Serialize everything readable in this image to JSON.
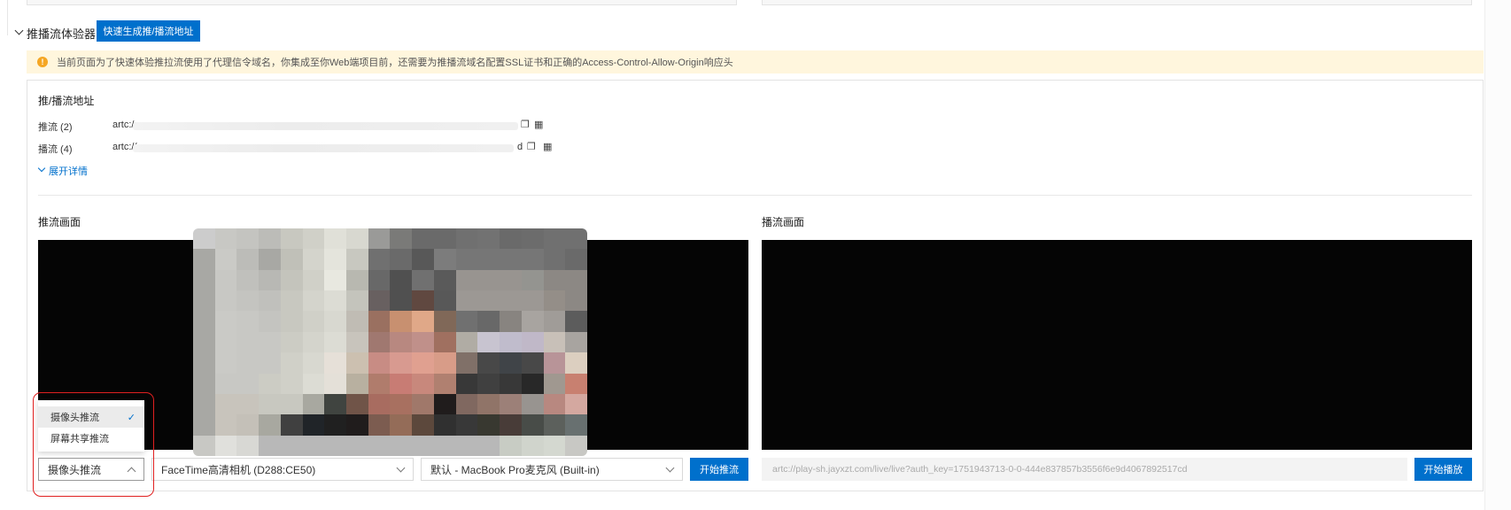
{
  "section": {
    "title": "推播流体验器",
    "generate_button": "快速生成推/播流地址"
  },
  "warning": "当前页面为了快速体验推拉流使用了代理信令域名，你集成至你Web端项目前，还需要为推播流域名配置SSL证书和正确的Access-Control-Allow-Origin响应头",
  "addresses": {
    "title": "推/播流地址",
    "rows": [
      {
        "label": "推流 (2)",
        "url": "artc:/",
        "icons": [
          "copy-icon",
          "qrcode-icon"
        ]
      },
      {
        "label": "播流 (4)",
        "url": "artc://",
        "suffix": "d",
        "icons": [
          "copy-icon",
          "qrcode-icon"
        ]
      }
    ],
    "expand": "展开详情"
  },
  "push": {
    "title": "推流画面",
    "source_select": "摄像头推流",
    "source_options": [
      {
        "label": "摄像头推流",
        "selected": true
      },
      {
        "label": "屏幕共享推流",
        "selected": false
      }
    ],
    "camera_select": "FaceTime高清相机 (D288:CE50)",
    "mic_select": "默认 - MacBook Pro麦克风 (Built-in)",
    "start_button": "开始推流"
  },
  "play": {
    "title": "播流画面",
    "url": "artc://play-sh.jayxzt.com/live/live?auth_key=1751943713-0-0-444e837857b3556f6e9d4067892517cd",
    "start_button": "开始播放"
  },
  "colors": {
    "primary": "#0070cc",
    "warning_bg": "#fff6dd",
    "highlight": "#e02020"
  }
}
